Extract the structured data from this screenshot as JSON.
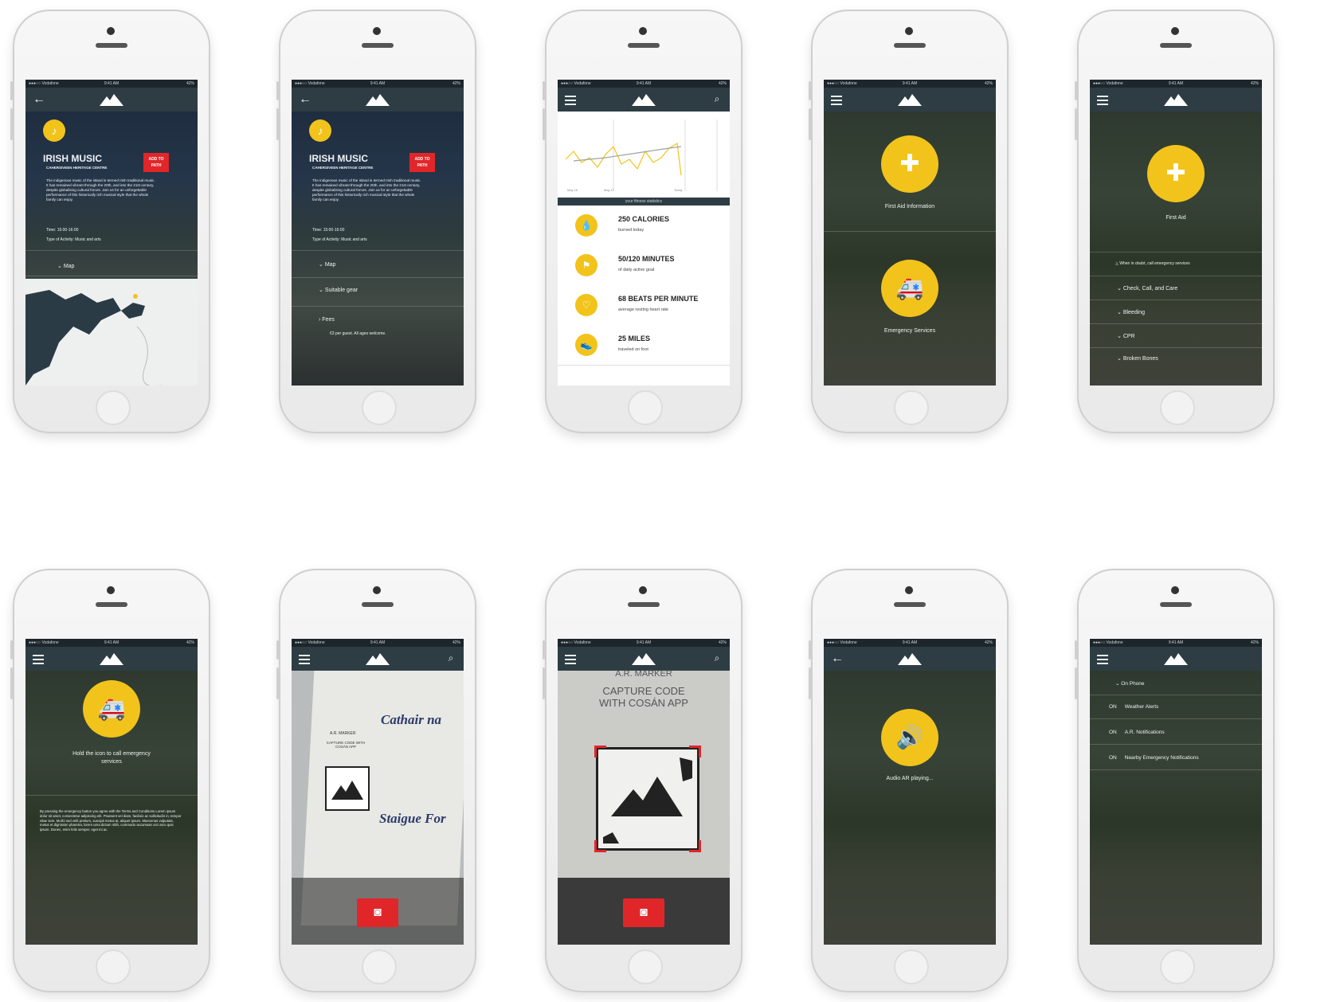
{
  "status": {
    "carrier": "●●●○○ Vodafone",
    "time": "9:41 AM",
    "battery": "42%"
  },
  "colors": {
    "accent_yellow": "#f2c31b",
    "accent_red": "#e1262a",
    "nav": "#2e3d44"
  },
  "screen1": {
    "title": "IRISH MUSIC",
    "subtitle": "CAHERSIVEEN HERITAGE CENTRE",
    "add_button": "ADD TO PATH",
    "body": "The indigenous music of the island is termed Irish traditional music. It has remained vibrant through the 20th, and into the 21st century, despite globalising cultural forces. Join us for an unforgettable performance of this historically rich musical style that the whole family can enjoy.",
    "time": "Time: 15:00-16:00",
    "activity": "Type of Activity: Music and arts",
    "map_label": "Map"
  },
  "screen2": {
    "title": "IRISH MUSIC",
    "subtitle": "CAHERSIVEEN HERITAGE CENTRE",
    "add_button": "ADD TO PATH",
    "body": "The indigenous music of the island is termed Irish traditional music. It has remained vibrant through the 20th, and into the 21st century, despite globalising cultural forces. Join us for an unforgettable performance of this historically rich musical style that the whole family can enjoy.",
    "time": "Time: 15:00-16:00",
    "activity": "Type of Activity: Music and arts",
    "map_label": "Map",
    "gear_label": "Suitable gear",
    "fees_label": "Fees",
    "fees_text": "€3 per guest. All ages welcome."
  },
  "screen3": {
    "chart_footer": "your fitness statistics",
    "axis_labels": [
      "May 16",
      "May 17",
      "Today"
    ],
    "stats": [
      {
        "title": "250 CALORIES",
        "sub": "burned today",
        "icon": "drop-icon"
      },
      {
        "title": "50/120 MINUTES",
        "sub": "of daily active goal",
        "icon": "flag-icon"
      },
      {
        "title": "68 BEATS PER MINUTE",
        "sub": "average resting heart rate",
        "icon": "heart-icon"
      },
      {
        "title": "25 MILES",
        "sub": "traveled on foot",
        "icon": "shoe-icon"
      }
    ]
  },
  "screen4": {
    "first_aid_label": "First Aid Information",
    "emergency_label": "Emergency Services"
  },
  "screen5": {
    "title": "First Aid",
    "warning": "When in doubt, call emergency services",
    "items": [
      "Check, Call, and Care",
      "Bleeding",
      "CPR",
      "Broken Bones"
    ]
  },
  "screen6": {
    "hold_text": "Hold the icon to call emergency services",
    "terms": "By pressing the emergency button you agree with the Terms and Conditions Lorem ipsum dolor sit amet, consectetur adipiscing elit. Praesent vel diam, facilisis ac sollicitudin in, tempor vitae sem. Morbi sed velit pretium, suscipit metus at, aliquet ipsum. Maecenas vulputate, metus et dignissim pharetra, lorem urna dictum nibh, commodo accumsan orci arcu quis ipsum. Donec, enim felis semper, eget mi ac."
  },
  "screen7": {
    "sign_marker": "A.R. MARKER",
    "sign_capture": "CAPTURE CODE WITH COSÁN APP",
    "sign_title1": "Cathair na",
    "sign_title2": "Staigue For"
  },
  "screen8": {
    "top_text": "A.R. MARKER",
    "capture_text": "CAPTURE CODE WITH COSÁN APP"
  },
  "screen9": {
    "audio_label": "Audio AR playing..."
  },
  "screen10": {
    "header_item": "On Phone",
    "settings": [
      {
        "state": "ON",
        "label": "Weather Alerts"
      },
      {
        "state": "ON",
        "label": "A.R. Notifications"
      },
      {
        "state": "ON",
        "label": "Nearby Emergency Notifications"
      }
    ]
  }
}
